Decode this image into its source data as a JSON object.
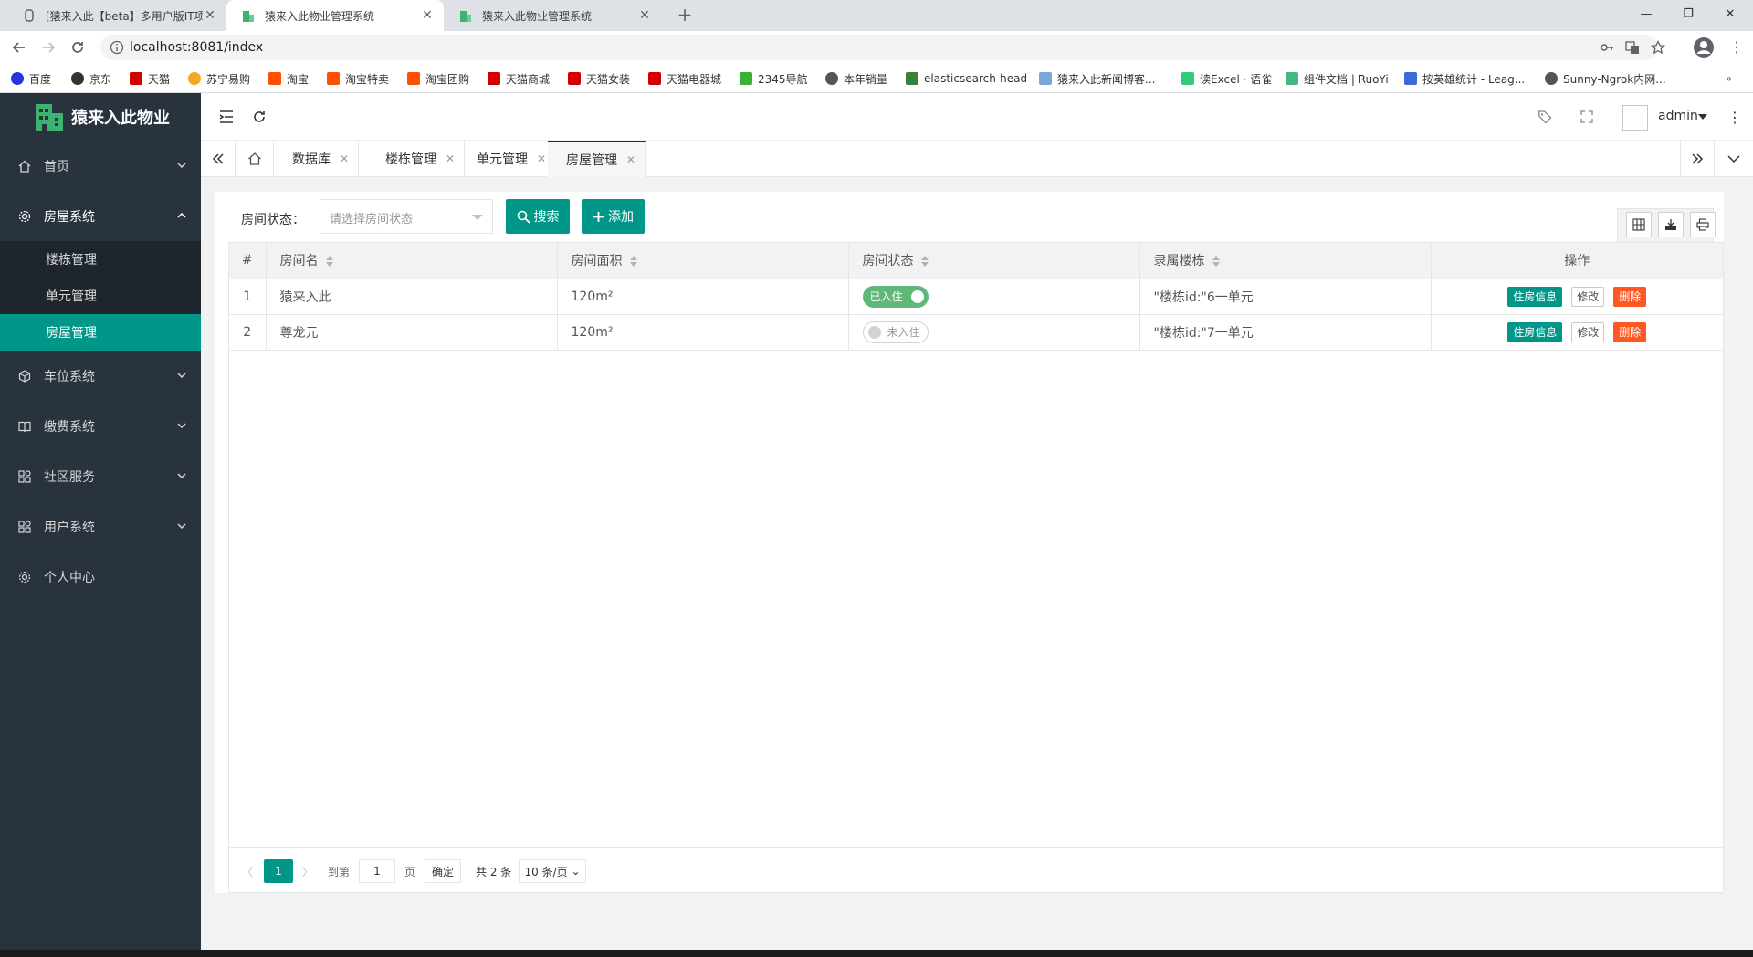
{
  "browser": {
    "tabs": [
      {
        "title": "[猿来入此【beta】多用户版IT项目"
      },
      {
        "title": "猿来入此物业管理系统"
      },
      {
        "title": "猿来入此物业管理系统"
      }
    ],
    "url": "localhost:8081/index",
    "bookmarks": [
      {
        "label": "百度",
        "color": "#2932e1"
      },
      {
        "label": "京东",
        "color": "#333333"
      },
      {
        "label": "天猫",
        "color": "#d40000"
      },
      {
        "label": "苏宁易购",
        "color": "#f5a623"
      },
      {
        "label": "淘宝",
        "color": "#ff5000"
      },
      {
        "label": "淘宝特卖",
        "color": "#ff5000"
      },
      {
        "label": "淘宝团购",
        "color": "#ff5000"
      },
      {
        "label": "天猫商城",
        "color": "#d40000"
      },
      {
        "label": "天猫女装",
        "color": "#d40000"
      },
      {
        "label": "天猫电器城",
        "color": "#d40000"
      },
      {
        "label": "2345导航",
        "color": "#3cb034"
      },
      {
        "label": "本年销量",
        "color": "#555555"
      },
      {
        "label": "elasticsearch-head",
        "color": "#3a7f3a"
      },
      {
        "label": "猿来入此新闻博客...",
        "color": "#7aa7d8"
      },
      {
        "label": "读Excel · 语雀",
        "color": "#31cc79"
      },
      {
        "label": "组件文档 | RuoYi",
        "color": "#42b983"
      },
      {
        "label": "按英雄统计 - Leag...",
        "color": "#3b6bd6"
      },
      {
        "label": "Sunny-Ngrok内网...",
        "color": "#555555"
      }
    ]
  },
  "app": {
    "title": "猿来入此物业",
    "user": "admin",
    "menu": [
      {
        "label": "首页"
      },
      {
        "label": "房屋系统"
      },
      {
        "label": "车位系统"
      },
      {
        "label": "缴费系统"
      },
      {
        "label": "社区服务"
      },
      {
        "label": "用户系统"
      },
      {
        "label": "个人中心"
      }
    ],
    "submenu": [
      {
        "label": "楼栋管理"
      },
      {
        "label": "单元管理"
      },
      {
        "label": "房屋管理"
      }
    ],
    "page_tabs": [
      {
        "label": "数据库"
      },
      {
        "label": "楼栋管理"
      },
      {
        "label": "单元管理"
      },
      {
        "label": "房屋管理"
      }
    ]
  },
  "filter": {
    "label": "房间状态：",
    "placeholder": "请选择房间状态",
    "search_label": "搜索",
    "add_label": "添加"
  },
  "table": {
    "columns": [
      "#",
      "房间名",
      "房间面积",
      "房间状态",
      "隶属楼栋",
      "操作"
    ],
    "rows": [
      {
        "num": "1",
        "name": "猿来入此",
        "area": "120m²",
        "status": "已入住",
        "occupied": true,
        "building": "\"楼栋id:\"6一单元",
        "ops": [
          "住房信息",
          "修改",
          "删除"
        ]
      },
      {
        "num": "2",
        "name": "尊龙元",
        "area": "120m²",
        "status": "未入住",
        "occupied": false,
        "building": "\"楼栋id:\"7一单元",
        "ops": [
          "住房信息",
          "修改",
          "删除"
        ]
      }
    ]
  },
  "pager": {
    "current": "1",
    "goto_label": "到第",
    "goto_value": "1",
    "page_label": "页",
    "confirm": "确定",
    "total": "共 2 条",
    "page_size": "10 条/页"
  }
}
